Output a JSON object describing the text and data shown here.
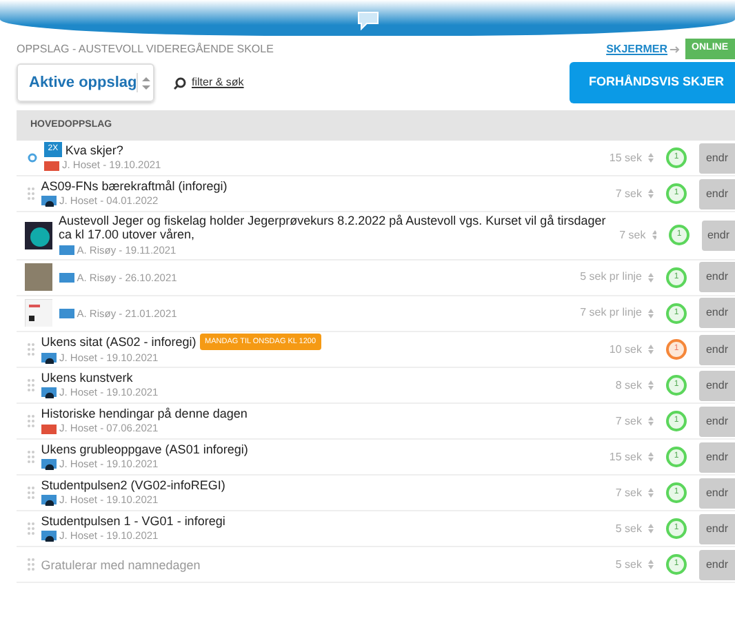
{
  "breadcrumb": "OPPSLAG - AUSTEVOLL VIDEREGÅENDE SKOLE",
  "screens_link": "SKJERMER",
  "screens_status": "ONLINE",
  "filter_select": {
    "value": "Aktive oppslag"
  },
  "filter_link": "filter & søk",
  "preview_button": "FORHÅNDSVIS SKJER",
  "section_title": "HOVEDOPPSLAG",
  "rows": [
    {
      "kind": "pinned",
      "tag": "2X",
      "title": "Kva skjer?",
      "media": {
        "kind": "slide",
        "color": "#e0503a"
      },
      "meta": "J. Hoset - 19.10.2021",
      "duration": "15 sek",
      "scheduled": false,
      "count": "1",
      "action": "endr"
    },
    {
      "kind": "text",
      "title": "AS09-FNs bærekraftmål (inforegi)",
      "media": {
        "kind": "screen",
        "color": "#3b8fd0"
      },
      "meta": "J. Hoset - 04.01.2022",
      "duration": "7 sek",
      "scheduled": false,
      "count": "1",
      "action": "endr"
    },
    {
      "kind": "thumb",
      "thumbnail": {
        "kind": "image"
      },
      "title": "Austevoll Jeger og fiskelag holder Jegerprøvekurs 8.2.2022 på Austevoll vgs. Kurset vil gå tirsdager ca kl 17.00 utover våren,",
      "media": {
        "kind": "slide",
        "color": "#3b8fd0"
      },
      "meta": "A. Risøy - 19.11.2021",
      "duration": "7 sek",
      "scheduled": false,
      "count": "1",
      "action": "endr"
    },
    {
      "kind": "thumb",
      "thumbnail": {
        "kind": "photo"
      },
      "media": {
        "kind": "slide",
        "color": "#3b8fd0"
      },
      "meta": "A. Risøy - 26.10.2021",
      "duration": "5 sek pr linje",
      "scheduled": false,
      "count": "1",
      "action": "endr"
    },
    {
      "kind": "thumb",
      "thumbnail": {
        "kind": "document"
      },
      "media": {
        "kind": "slide",
        "color": "#3b8fd0"
      },
      "meta": "A. Risøy - 21.01.2021",
      "duration": "7 sek pr linje",
      "scheduled": false,
      "count": "1",
      "action": "endr"
    },
    {
      "kind": "text",
      "title": "Ukens sitat (AS02 - inforegi)",
      "badge": "MANDAG TIL ONSDAG KL 1200",
      "media": {
        "kind": "screen",
        "color": "#3b8fd0"
      },
      "meta": "J. Hoset - 19.10.2021",
      "duration": "10 sek",
      "scheduled": true,
      "count": "1",
      "action": "endr"
    },
    {
      "kind": "text",
      "title": "Ukens kunstverk",
      "media": {
        "kind": "screen",
        "color": "#3b8fd0"
      },
      "meta": "J. Hoset - 19.10.2021",
      "duration": "8 sek",
      "scheduled": false,
      "count": "1",
      "action": "endr"
    },
    {
      "kind": "text",
      "title": "Historiske hendingar på denne dagen",
      "media": {
        "kind": "slide",
        "color": "#e0503a"
      },
      "meta": "J. Hoset - 07.06.2021",
      "duration": "7 sek",
      "scheduled": false,
      "count": "1",
      "action": "endr"
    },
    {
      "kind": "text",
      "title": "Ukens grubleoppgave (AS01 inforegi)",
      "media": {
        "kind": "screen",
        "color": "#3b8fd0"
      },
      "meta": "J. Hoset - 19.10.2021",
      "duration": "15 sek",
      "scheduled": false,
      "count": "1",
      "action": "endr"
    },
    {
      "kind": "text",
      "title": "Studentpulsen2 (VG02-infoREGI)",
      "media": {
        "kind": "screen",
        "color": "#3b8fd0"
      },
      "meta": "J. Hoset - 19.10.2021",
      "duration": "7 sek",
      "scheduled": false,
      "count": "1",
      "action": "endr"
    },
    {
      "kind": "text",
      "title": "Studentpulsen 1 - VG01 - inforegi",
      "media": {
        "kind": "screen",
        "color": "#3b8fd0"
      },
      "meta": "J. Hoset - 19.10.2021",
      "duration": "5 sek",
      "scheduled": false,
      "count": "1",
      "action": "endr"
    },
    {
      "kind": "text",
      "title": "Gratulerar med namnedagen",
      "faded": true,
      "duration": "5 sek",
      "scheduled": false,
      "count": "1",
      "action": "endr"
    }
  ]
}
